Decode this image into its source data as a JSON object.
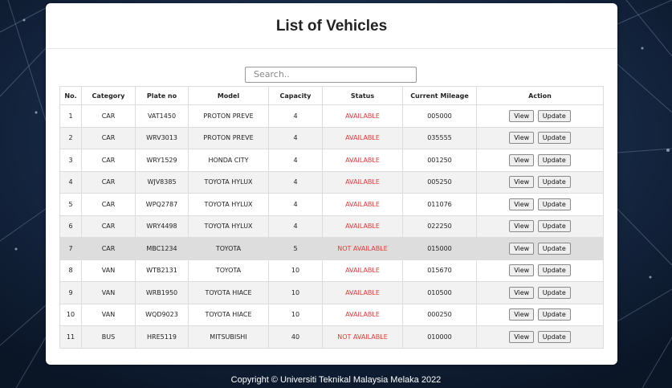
{
  "page": {
    "title": "List of Vehicles"
  },
  "search": {
    "placeholder": "Search.."
  },
  "table": {
    "headers": [
      "No.",
      "Category",
      "Plate no",
      "Model",
      "Capacity",
      "Status",
      "Current Mileage",
      "Action"
    ],
    "rows": [
      [
        "1",
        "CAR",
        "VAT1450",
        "PROTON PREVE",
        "4",
        "AVAILABLE",
        "005000"
      ],
      [
        "2",
        "CAR",
        "WRV3013",
        "PROTON PREVE",
        "4",
        "AVAILABLE",
        "035555"
      ],
      [
        "3",
        "CAR",
        "WRY1529",
        "HONDA CITY",
        "4",
        "AVAILABLE",
        "001250"
      ],
      [
        "4",
        "CAR",
        "WJV8385",
        "TOYOTA HYLUX",
        "4",
        "AVAILABLE",
        "005250"
      ],
      [
        "5",
        "CAR",
        "WPQ2787",
        "TOYOTA HYLUX",
        "4",
        "AVAILABLE",
        "011076"
      ],
      [
        "6",
        "CAR",
        "WRY4498",
        "TOYOTA HYLUX",
        "4",
        "AVAILABLE",
        "022250"
      ],
      [
        "7",
        "CAR",
        "MBC1234",
        "TOYOTA",
        "5",
        "NOT AVAILABLE",
        "015000"
      ],
      [
        "8",
        "VAN",
        "WTB2131",
        "TOYOTA",
        "10",
        "AVAILABLE",
        "015670"
      ],
      [
        "9",
        "VAN",
        "WRB1950",
        "TOYOTA HIACE",
        "10",
        "AVAILABLE",
        "010500"
      ],
      [
        "10",
        "VAN",
        "WQD9023",
        "TOYOTA HIACE",
        "10",
        "AVAILABLE",
        "000250"
      ],
      [
        "11",
        "BUS",
        "HRE5119",
        "MITSUBISHI",
        "40",
        "NOT AVAILABLE",
        "010000"
      ]
    ],
    "actions": {
      "view_label": "View",
      "update_label": "Update"
    }
  },
  "colors": {
    "status_text": "#e53935",
    "background": "#0f1f3a",
    "row_alt": "#f2f2f2",
    "row_hover": "#dddddd"
  },
  "footer": {
    "text": "Copyright © Universiti Teknikal Malaysia Melaka 2022"
  }
}
